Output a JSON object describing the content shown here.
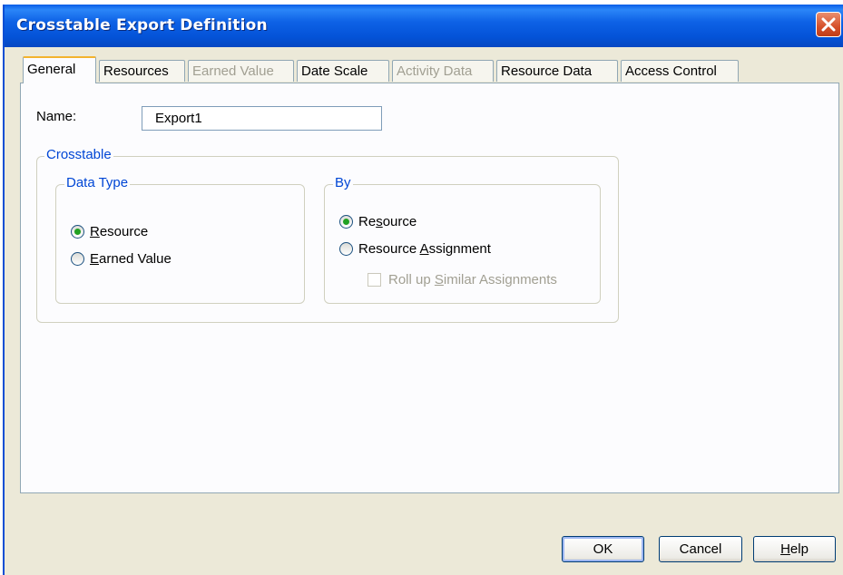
{
  "window": {
    "title": "Crosstable Export Definition"
  },
  "tabs": [
    {
      "label": "General",
      "active": true,
      "enabled": true
    },
    {
      "label": "Resources",
      "enabled": true
    },
    {
      "label": "Earned Value",
      "enabled": false
    },
    {
      "label": "Date Scale",
      "enabled": true
    },
    {
      "label": "Activity Data",
      "enabled": false
    },
    {
      "label": "Resource  Data",
      "enabled": true
    },
    {
      "label": "Access Control",
      "enabled": true
    }
  ],
  "form": {
    "name_label": "Name:",
    "name_value": "Export1",
    "crosstable": {
      "legend": "Crosstable",
      "data_type": {
        "legend": "Data Type",
        "options": [
          {
            "label": "Resource",
            "mnemonic": "R",
            "rest": "esource",
            "checked": true
          },
          {
            "label": "Earned Value",
            "mnemonic": "E",
            "rest": "arned Value",
            "checked": false
          }
        ]
      },
      "by": {
        "legend": "By",
        "options": [
          {
            "label": "Resource",
            "pre": "Re",
            "mnemonic": "s",
            "rest": "ource",
            "checked": true
          },
          {
            "label": "Resource Assignment",
            "pre": "Resource ",
            "mnemonic": "A",
            "rest": "ssignment",
            "checked": false
          }
        ],
        "rollup": {
          "label": "Roll up Similar Assignments",
          "pre": "Roll up ",
          "mnemonic": "S",
          "rest": "imilar Assignments",
          "checked": false,
          "enabled": false
        }
      }
    }
  },
  "buttons": {
    "ok": "OK",
    "cancel": "Cancel",
    "help_mnemonic": "H",
    "help_rest": "elp"
  },
  "icons": {
    "close": "close-icon"
  },
  "colors": {
    "titlebar": "#0453d8",
    "active_tab_accent": "#f3b32d",
    "group_legend": "#0046d5",
    "radio_dot": "#21a121"
  }
}
